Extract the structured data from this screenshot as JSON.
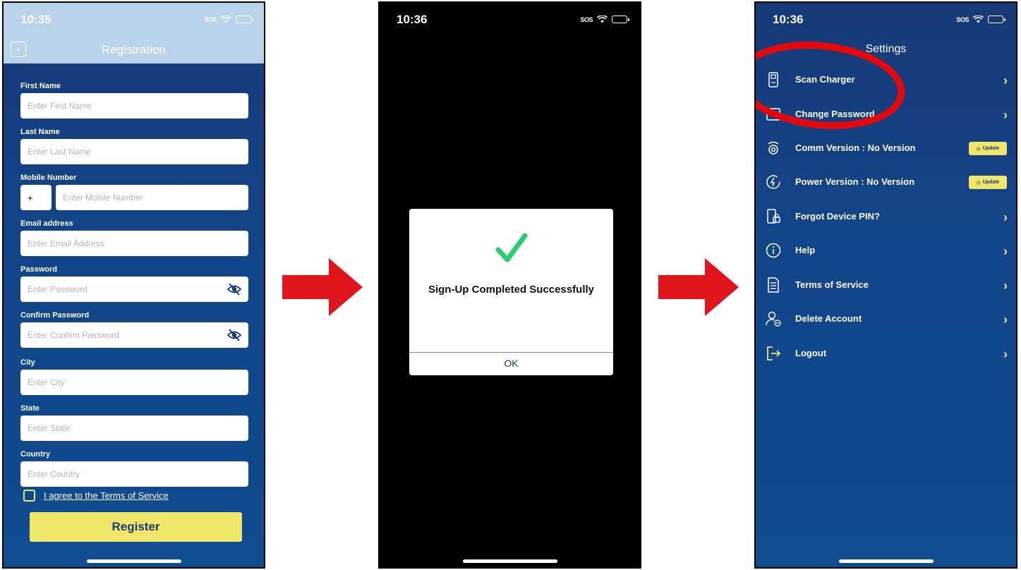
{
  "screen1": {
    "time": "10:35",
    "sos": "SOS",
    "title": "Registration",
    "fields": {
      "first_name": {
        "label": "First Name",
        "placeholder": "Enter First Name"
      },
      "last_name": {
        "label": "Last Name",
        "placeholder": "Enter Last Name"
      },
      "mobile": {
        "label": "Mobile Number",
        "code": "+",
        "placeholder": "Enter Mobile Number"
      },
      "email": {
        "label": "Email address",
        "placeholder": "Enter Email Address"
      },
      "password": {
        "label": "Password",
        "placeholder": "Enter Password"
      },
      "confirm": {
        "label": "Confirm Password",
        "placeholder": "Enter Confirm Password"
      },
      "city": {
        "label": "City",
        "placeholder": "Enter City"
      },
      "state": {
        "label": "State",
        "placeholder": "Enter State"
      },
      "country": {
        "label": "Country",
        "placeholder": "Enter Country"
      }
    },
    "terms": "I agree to the Terms of Service",
    "register": "Register"
  },
  "screen2": {
    "time": "10:36",
    "sos": "SOS",
    "message": "Sign-Up Completed Successfully",
    "ok": "OK"
  },
  "screen3": {
    "time": "10:36",
    "sos": "SOS",
    "title": "Settings",
    "items": [
      {
        "label": "Scan Charger",
        "icon": "charger-icon"
      },
      {
        "label": "Change Password",
        "icon": "password-icon"
      },
      {
        "label": "Comm Version : No Version",
        "icon": "comm-icon",
        "action": "Update"
      },
      {
        "label": "Power Version : No Version",
        "icon": "power-icon",
        "action": "Update"
      },
      {
        "label": "Forgot Device PIN?",
        "icon": "device-pin-icon"
      },
      {
        "label": "Help",
        "icon": "info-icon"
      },
      {
        "label": "Terms of Service",
        "icon": "document-icon"
      },
      {
        "label": "Delete Account",
        "icon": "delete-user-icon"
      },
      {
        "label": "Logout",
        "icon": "logout-icon"
      }
    ]
  },
  "colors": {
    "accent": "#f0e66a",
    "primary": "#173a78",
    "highlight": "#e4080a",
    "success": "#2ecc71"
  }
}
